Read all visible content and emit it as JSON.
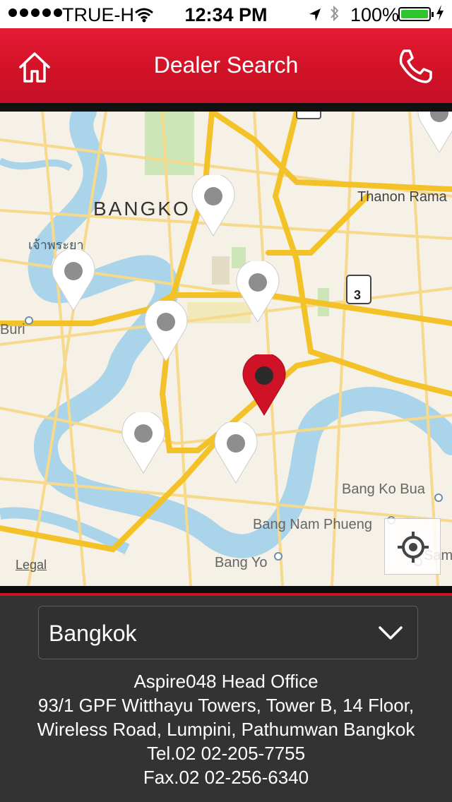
{
  "status_bar": {
    "carrier": "TRUE-H",
    "time": "12:34 PM",
    "battery": "100%"
  },
  "header": {
    "title": "Dealer Search",
    "home_icon": "home-icon",
    "phone_icon": "phone-icon"
  },
  "map": {
    "city_label": "BANGKO",
    "labels": {
      "thai": "เจ้าพระยา",
      "buri": "Buri",
      "rama": "Thanon Rama I",
      "bang_ko_bua": "Bang Ko Bua",
      "bang_nam_phueng": "Bang Nam Phueng",
      "bang_yo": "Bang Yo",
      "sam": "Sam",
      "route": "3",
      "legal": "Legal"
    },
    "locate_icon": "locate-icon"
  },
  "dropdown": {
    "selected": "Bangkok"
  },
  "dealer": {
    "name": "Aspire048 Head Office",
    "address1": "93/1 GPF Witthayu Towers, Tower B, 14 Floor,",
    "address2": "Wireless Road, Lumpini, Pathumwan Bangkok",
    "tel": "Tel.02 02-205-7755",
    "fax": "Fax.02 02-256-6340"
  },
  "colors": {
    "brand_red": "#d01226",
    "pin_white": "#ffffff",
    "road_yellow": "#f2c228",
    "water_blue": "#a9d4ea"
  }
}
